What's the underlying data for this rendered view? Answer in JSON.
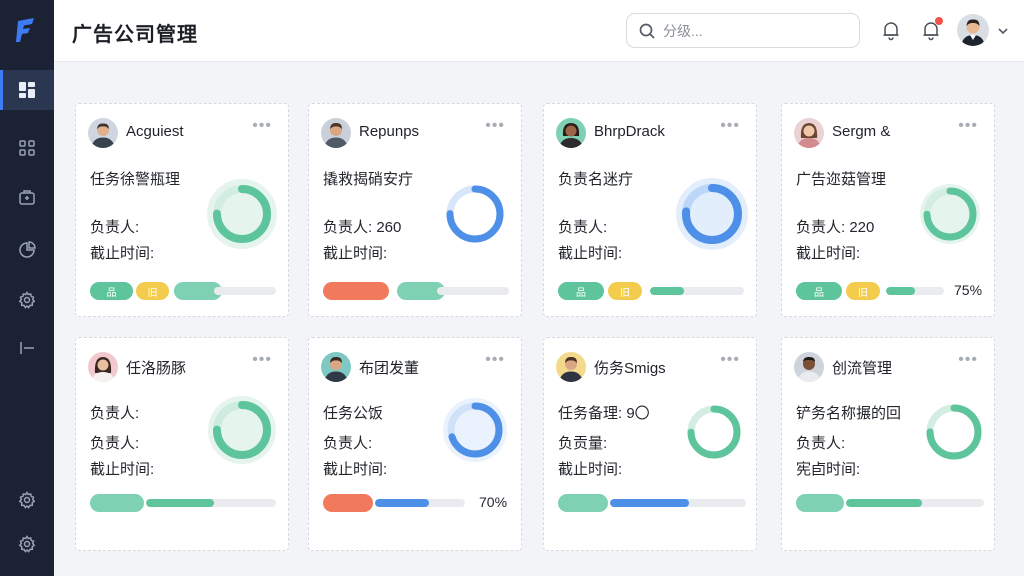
{
  "app": {
    "title": "广告公司管理",
    "colors": {
      "sidebar": "#1b2233",
      "accent": "#3d7bf5",
      "green": "#5ec49c",
      "blue": "#4e8fe8",
      "orange": "#f27a5c",
      "yellow": "#f3cc4e"
    }
  },
  "sidebar": {
    "items": [
      {
        "name": "dashboard",
        "icon": "grid-layout-icon",
        "active": true
      },
      {
        "name": "apps",
        "icon": "apps-icon"
      },
      {
        "name": "share",
        "icon": "share-box-icon"
      },
      {
        "name": "reports",
        "icon": "pie-chart-icon"
      },
      {
        "name": "settings",
        "icon": "gear-icon"
      },
      {
        "name": "collapse",
        "icon": "collapse-icon"
      }
    ],
    "bottom": [
      {
        "name": "settings-alt",
        "icon": "gear-icon"
      },
      {
        "name": "settings-more",
        "icon": "gear-icon"
      }
    ]
  },
  "header": {
    "search_placeholder": "分级...",
    "notifications": {
      "icon": "bell-icon"
    },
    "alerts": {
      "icon": "bell-icon",
      "has_dot": true
    },
    "user": {
      "icon": "avatar"
    }
  },
  "cards": [
    {
      "name": "Acguiest",
      "title": "任务徐警瓶理",
      "line2": "负责人:",
      "line3": "截止时间:",
      "progress": 0.75,
      "ring_color": "#5ec49c",
      "tags": [
        "green",
        "yellow"
      ],
      "bar_color": "green",
      "tag_text": [
        "品",
        "旧"
      ]
    },
    {
      "name": "Repunps",
      "title": "撬救揭硝安疔",
      "line2": "负责人: 260",
      "line3": "截止时间:",
      "progress": 0.75,
      "ring_color": "#4e8fe8",
      "tags": [
        "orange"
      ],
      "bar_color": "green"
    },
    {
      "name": "BhrpDrack",
      "title": "负责名迷疔",
      "line2": "负责人:",
      "line3": "截止时间:",
      "progress": 0.75,
      "ring_color": "#4e8fe8",
      "tags": [
        "green",
        "yellow"
      ],
      "bar_color": "green",
      "tag_text": [
        "品",
        "旧"
      ]
    },
    {
      "name": "Sergm &",
      "title": "广告迩菇管理",
      "line2": "负责人: 220",
      "line3": "截止时间:",
      "progress": 0.75,
      "ring_color": "#5ec49c",
      "tags": [
        "green",
        "yellow"
      ],
      "bar_color": "green",
      "tag_text": [
        "品",
        "旧"
      ],
      "pct": "75%"
    },
    {
      "name": "任洛肠豚",
      "title": "负责人:",
      "line2": "负责人:",
      "line3": "截止时间:",
      "progress": 0.75,
      "ring_color": "#5ec49c",
      "tags": [
        "green"
      ],
      "bar_color": "green"
    },
    {
      "name": "布团发董",
      "title": "任务公饭",
      "line2": "负责人:",
      "line3": "截止时间:",
      "progress": 0.7,
      "ring_color": "#4e8fe8",
      "tags": [
        "orange"
      ],
      "bar_color": "blue",
      "pct": "70%"
    },
    {
      "name": "伤务Smigs",
      "title": "任务备理: 9〇",
      "line2": "负贡量:",
      "line3": "截止时间:",
      "progress": 0.75,
      "ring_color": "#5ec49c",
      "tags": [
        "green"
      ],
      "bar_color": "blue"
    },
    {
      "name": "创流管理",
      "title": "铲务名称搌的回",
      "line2": "负责人:",
      "line3": "宪卣时间:",
      "progress": 0.75,
      "ring_color": "#5ec49c",
      "tags": [
        "green"
      ],
      "bar_color": "green"
    }
  ]
}
